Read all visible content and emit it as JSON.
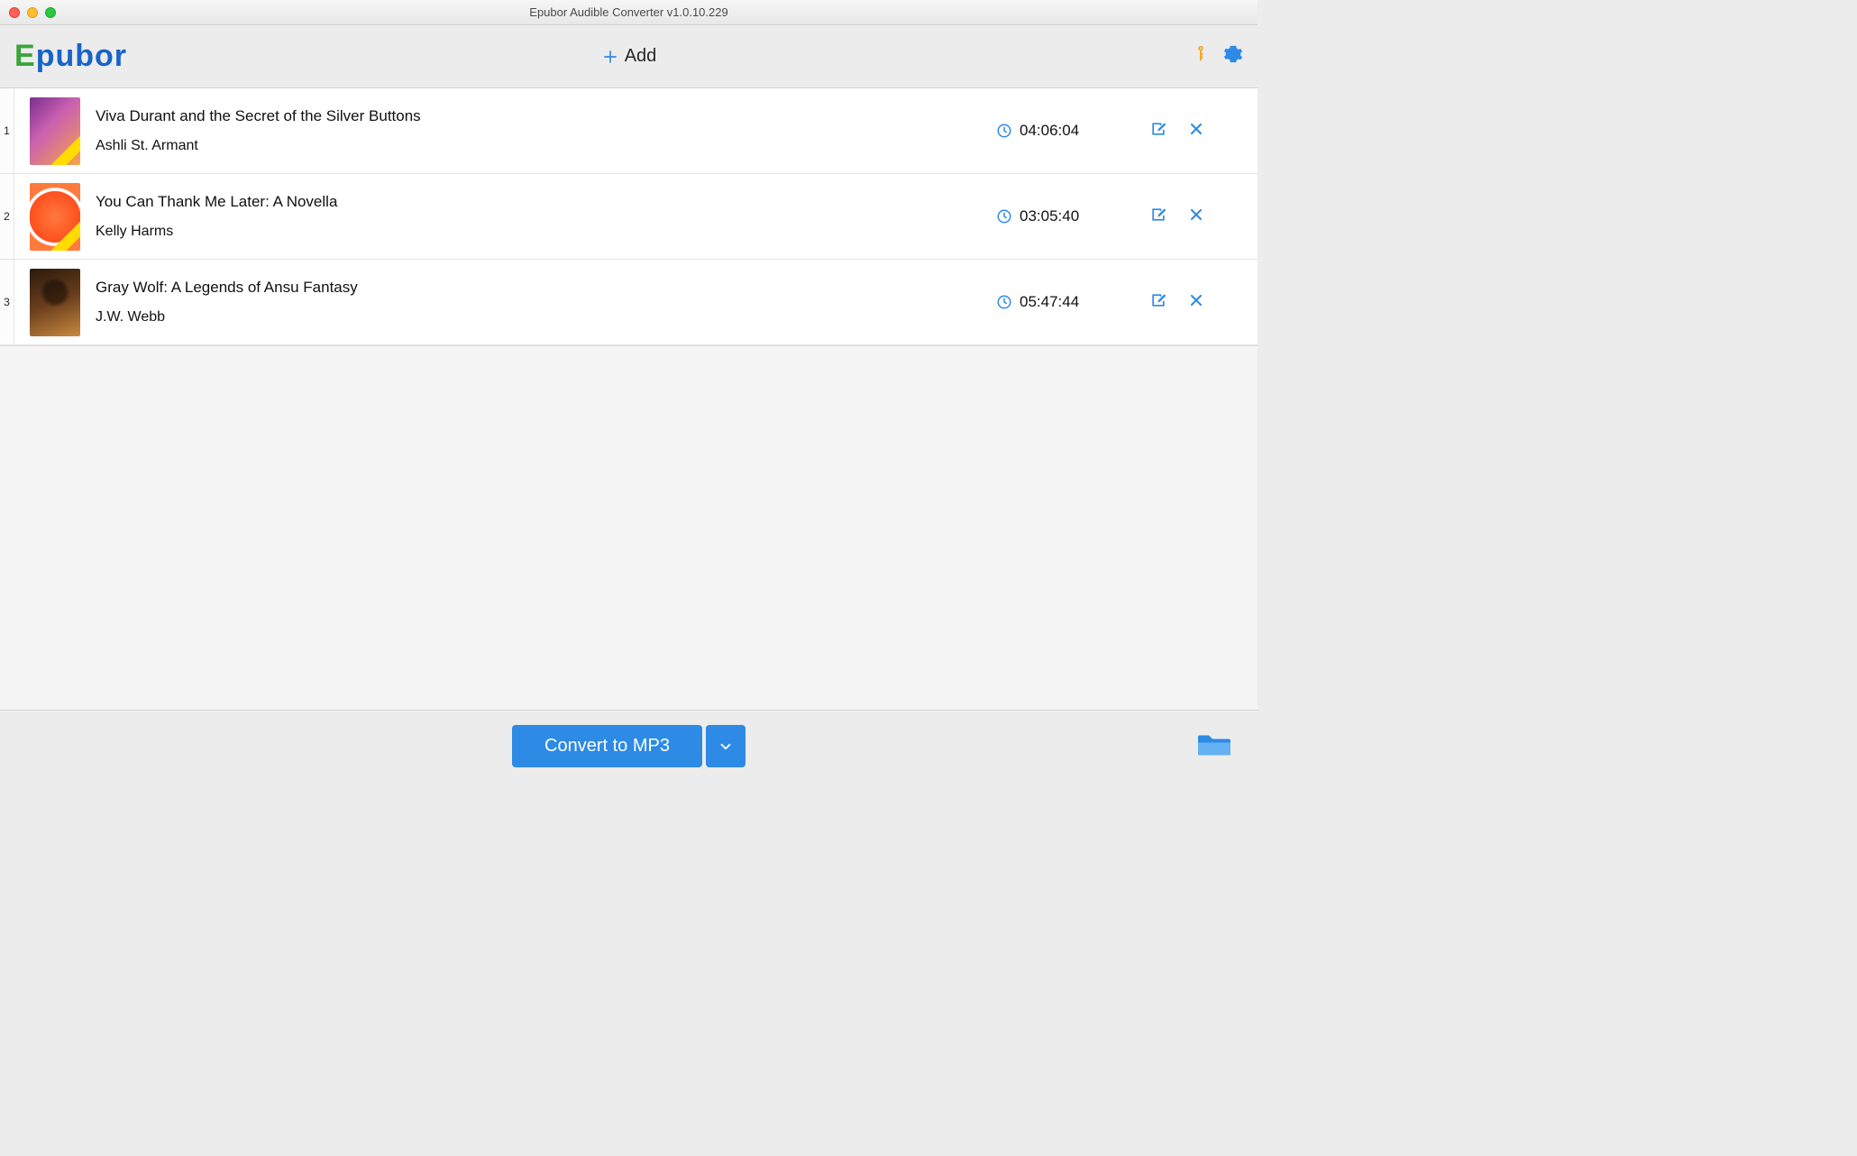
{
  "window": {
    "title": "Epubor Audible Converter v1.0.10.229"
  },
  "toolbar": {
    "logo_e": "E",
    "logo_rest": "pubor",
    "add_label": "Add"
  },
  "items": [
    {
      "index": "1",
      "title": "Viva Durant and the Secret of the Silver Buttons",
      "author": "Ashli St. Armant",
      "duration": "04:06:04",
      "cover": "cover-1",
      "show_band": true
    },
    {
      "index": "2",
      "title": "You Can Thank Me Later: A Novella",
      "author": "Kelly Harms",
      "duration": "03:05:40",
      "cover": "cover-2",
      "show_band": true
    },
    {
      "index": "3",
      "title": "Gray Wolf: A Legends of Ansu Fantasy",
      "author": "J.W. Webb",
      "duration": "05:47:44",
      "cover": "cover-3",
      "show_band": false
    }
  ],
  "bottom": {
    "convert_label": "Convert to MP3"
  }
}
